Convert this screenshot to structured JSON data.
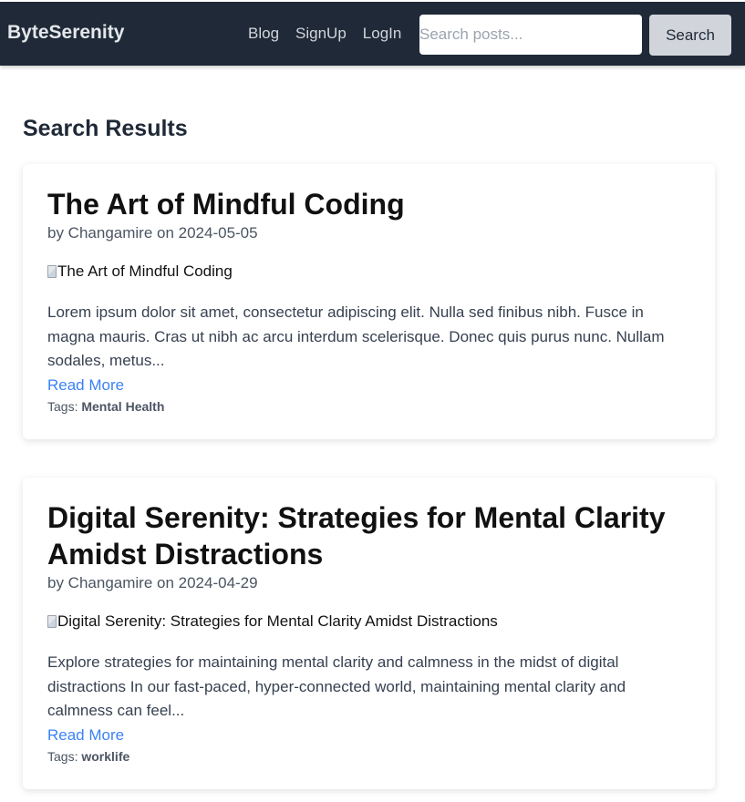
{
  "nav": {
    "brand": "ByteSerenity",
    "links": [
      "Blog",
      "SignUp",
      "LogIn"
    ],
    "search_placeholder": "Search posts...",
    "search_button": "Search"
  },
  "main": {
    "title": "Search Results",
    "posts": [
      {
        "title": "The Art of Mindful Coding",
        "meta": "by Changamire on 2024-05-05",
        "image_alt": "The Art of Mindful Coding",
        "excerpt": "Lorem ipsum dolor sit amet, consectetur adipiscing elit. Nulla sed finibus nibh. Fusce in magna mauris. Cras ut nibh ac arcu interdum scelerisque. Donec quis purus nunc. Nullam sodales, metus...",
        "read_more": "Read More",
        "tags_label": "Tags:",
        "tags": "Mental Health"
      },
      {
        "title": "Digital Serenity: Strategies for Mental Clarity Amidst Distractions",
        "meta": "by Changamire on 2024-04-29",
        "image_alt": "Digital Serenity: Strategies for Mental Clarity Amidst Distractions",
        "excerpt": "Explore strategies for maintaining mental clarity and calmness in the midst of digital distractions In our fast-paced, hyper-connected world, maintaining mental clarity and calmness can feel...",
        "read_more": "Read More",
        "tags_label": "Tags:",
        "tags": "worklife"
      }
    ]
  }
}
